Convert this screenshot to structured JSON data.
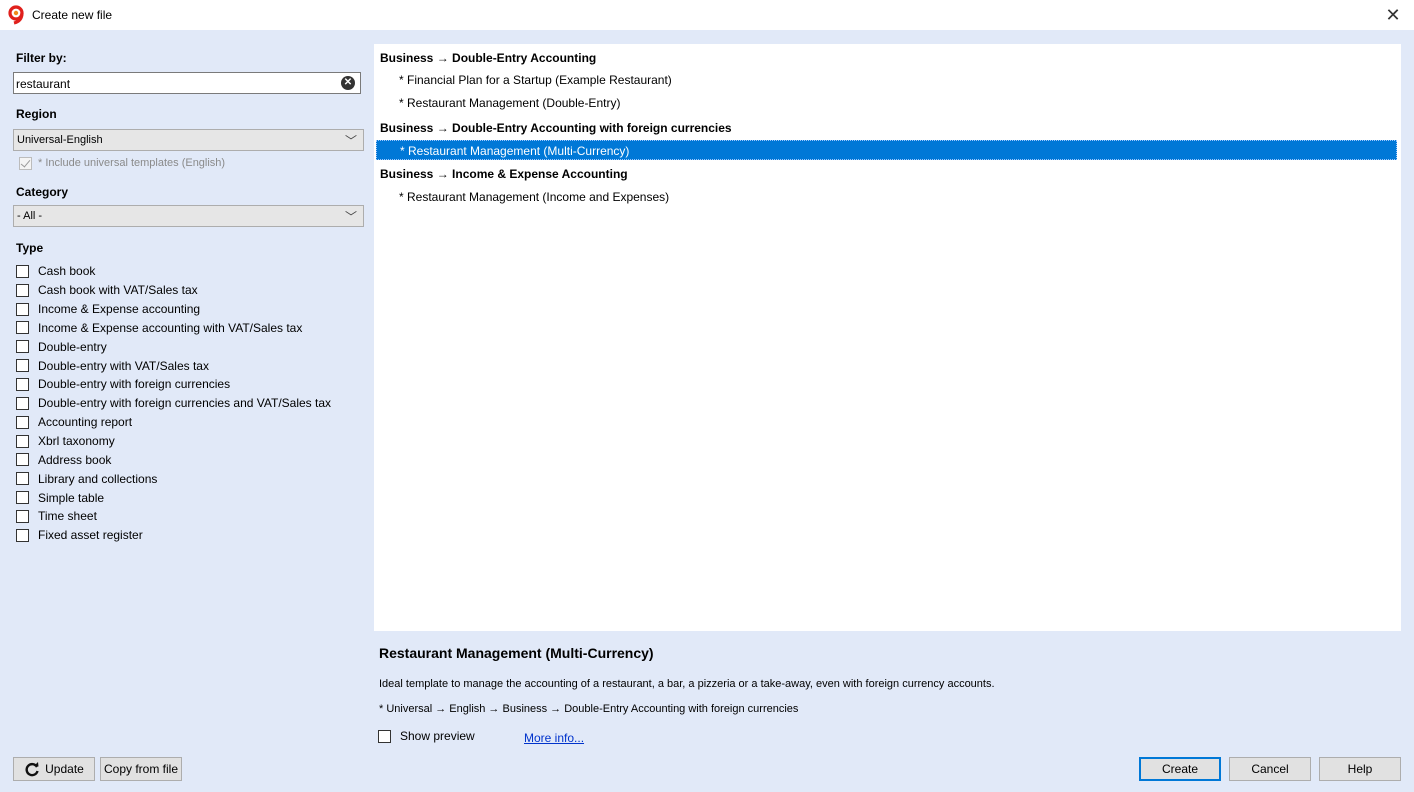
{
  "window": {
    "title": "Create new file",
    "close_glyph": "✕"
  },
  "filter": {
    "label": "Filter by:",
    "value": "restaurant",
    "clear_glyph": "✕"
  },
  "region": {
    "label": "Region",
    "selected": "Universal-English",
    "include_label": "* Include universal templates (English)"
  },
  "category": {
    "label": "Category",
    "selected": "- All -"
  },
  "type": {
    "label": "Type",
    "items": [
      "Cash book",
      "Cash book with VAT/Sales tax",
      "Income & Expense accounting",
      "Income & Expense accounting with VAT/Sales tax",
      "Double-entry",
      "Double-entry with VAT/Sales tax",
      "Double-entry with foreign currencies",
      "Double-entry with foreign currencies and VAT/Sales tax",
      "Accounting report",
      "Xbrl taxonomy",
      "Address book",
      "Library and collections",
      "Simple table",
      "Time sheet",
      "Fixed asset register"
    ]
  },
  "templates": {
    "groups": [
      {
        "header": "Business → Double-Entry Accounting",
        "items": [
          "* Financial Plan for a Startup (Example Restaurant)",
          "* Restaurant Management (Double-Entry)"
        ]
      },
      {
        "header": "Business → Double-Entry Accounting with foreign currencies",
        "items": [
          "* Restaurant Management (Multi-Currency)"
        ]
      },
      {
        "header": "Business → Income & Expense Accounting",
        "items": [
          "* Restaurant Management (Income and Expenses)"
        ]
      }
    ],
    "selected": "* Restaurant Management (Multi-Currency)"
  },
  "detail": {
    "title": "Restaurant Management (Multi-Currency)",
    "description": "Ideal template to manage the accounting of a restaurant, a bar, a pizzeria or a take-away, even with foreign currency accounts.",
    "path": "* Universal → English → Business → Double-Entry Accounting with foreign currencies",
    "show_preview_label": "Show preview",
    "more_info_label": "More info..."
  },
  "buttons": {
    "update": "Update",
    "copy_from_file": "Copy from file",
    "create": "Create",
    "cancel": "Cancel",
    "help": "Help"
  },
  "colors": {
    "background": "#e1e9f8",
    "selection": "#0078d7",
    "app_icon_red": "#e0201c",
    "app_icon_orange": "#f08a1c"
  }
}
